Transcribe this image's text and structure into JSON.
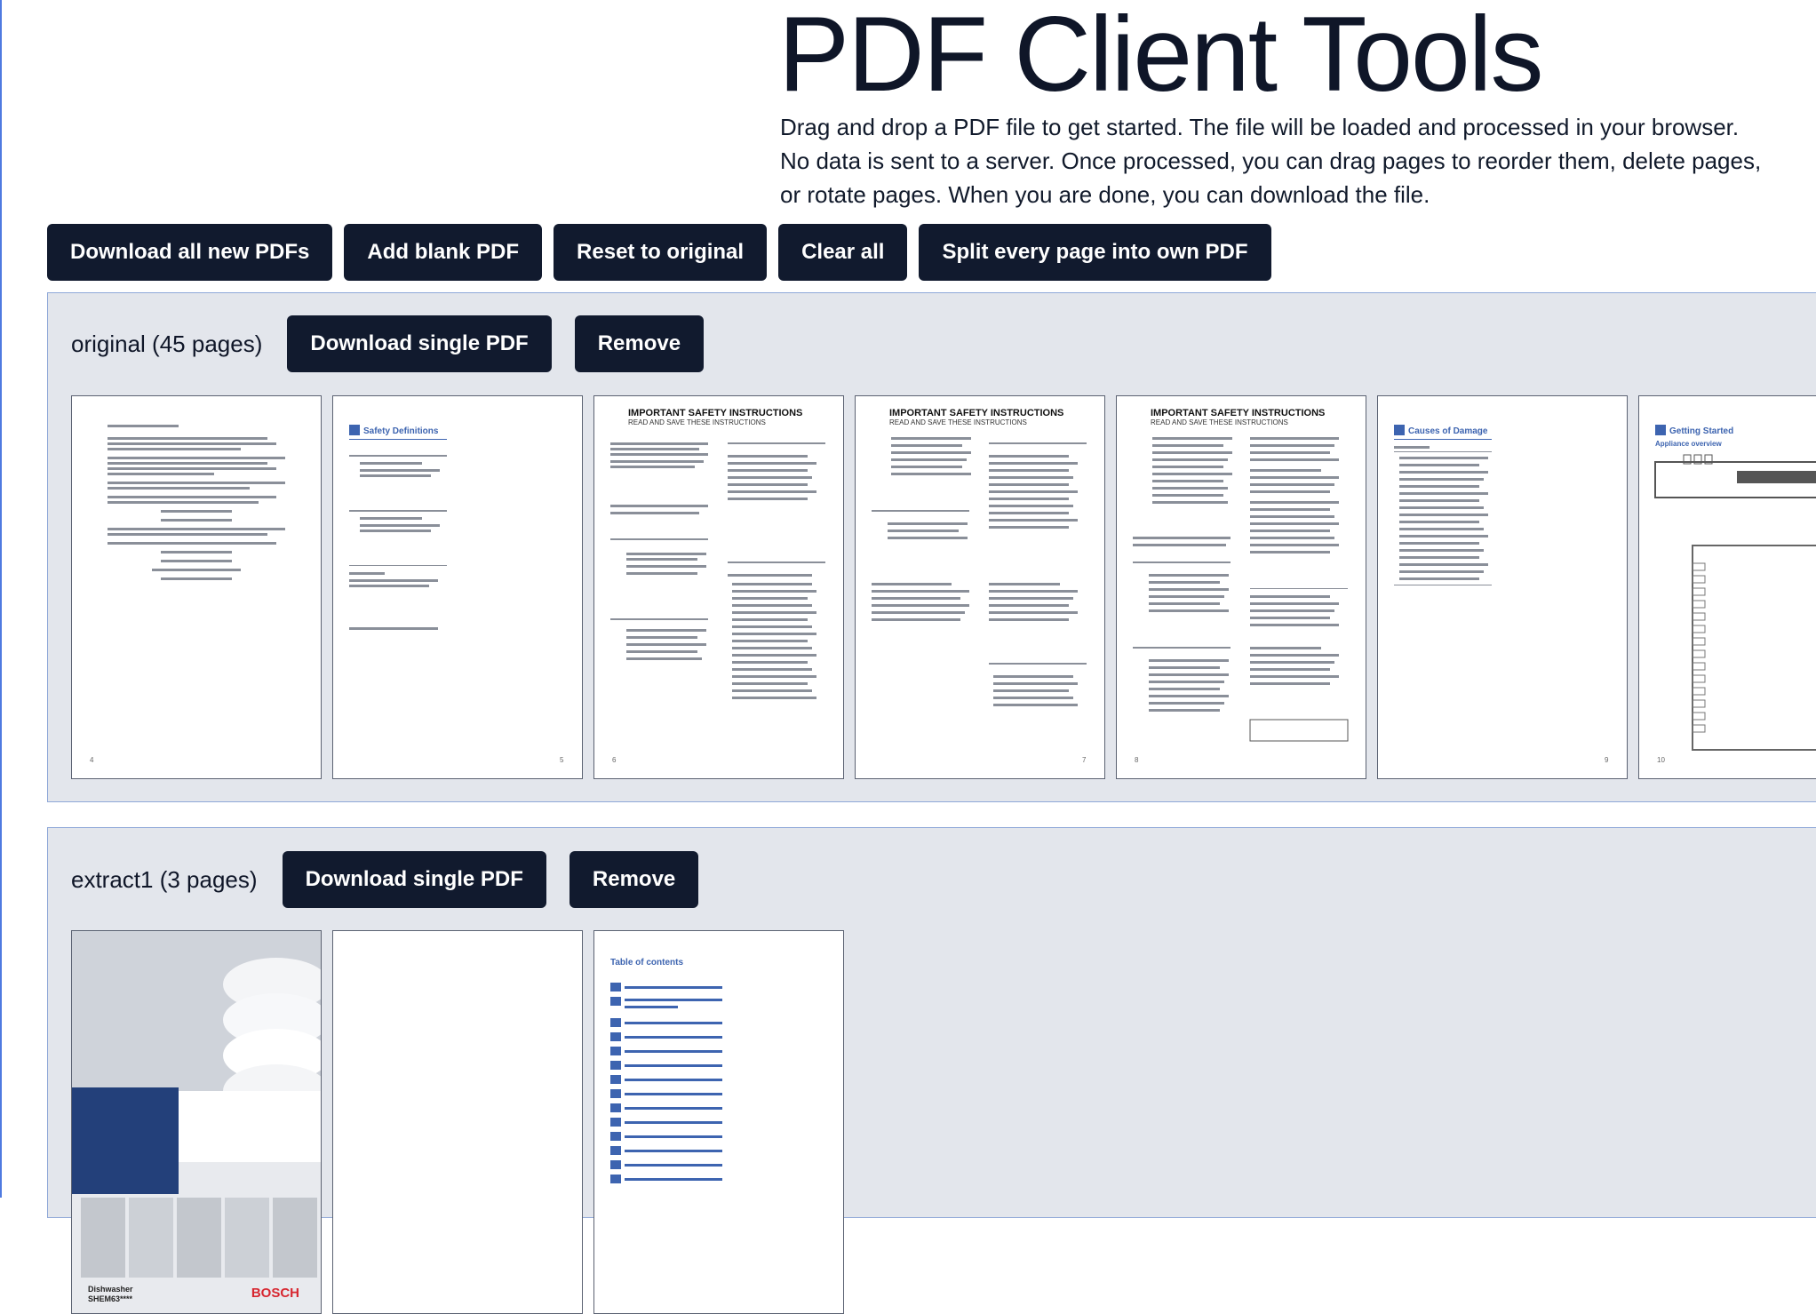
{
  "header": {
    "title": "PDF Client Tools",
    "description": "Drag and drop a PDF file to get started. The file will be loaded and processed in your browser. No data is sent to a server. Once processed, you can drag pages to reorder them, delete pages, or rotate pages. When you are done, you can download the file."
  },
  "toolbar": {
    "download_all": "Download all new PDFs",
    "add_blank": "Add blank PDF",
    "reset": "Reset to original",
    "clear_all": "Clear all",
    "split": "Split every page into own PDF"
  },
  "groups": [
    {
      "title": "original (45 pages)",
      "download_label": "Download single PDF",
      "remove_label": "Remove",
      "pages": [
        {
          "heading": "",
          "page_no": "4"
        },
        {
          "heading": "Safety Definitions",
          "page_no": "5"
        },
        {
          "heading": "IMPORTANT SAFETY INSTRUCTIONS",
          "subheading": "READ AND SAVE THESE INSTRUCTIONS",
          "page_no": "6"
        },
        {
          "heading": "IMPORTANT SAFETY INSTRUCTIONS",
          "subheading": "READ AND SAVE THESE INSTRUCTIONS",
          "page_no": "7"
        },
        {
          "heading": "IMPORTANT SAFETY INSTRUCTIONS",
          "subheading": "READ AND SAVE THESE INSTRUCTIONS",
          "page_no": "8"
        },
        {
          "heading": "Causes of Damage",
          "page_no": "9"
        },
        {
          "heading": "Getting Started",
          "subheading": "Appliance overview",
          "page_no": "10"
        }
      ]
    },
    {
      "title": "extract1 (3 pages)",
      "download_label": "Download single PDF",
      "remove_label": "Remove",
      "pages": [
        {
          "brand": "BOSCH",
          "model": "Dishwasher",
          "model_code": "SHEM63****"
        },
        {
          "heading": ""
        },
        {
          "heading": "Table of contents"
        }
      ]
    }
  ],
  "colors": {
    "button_bg": "#111a2e",
    "group_bg": "#e3e6ec",
    "group_border": "#8fa8d8",
    "accent": "#4f7ae0"
  }
}
